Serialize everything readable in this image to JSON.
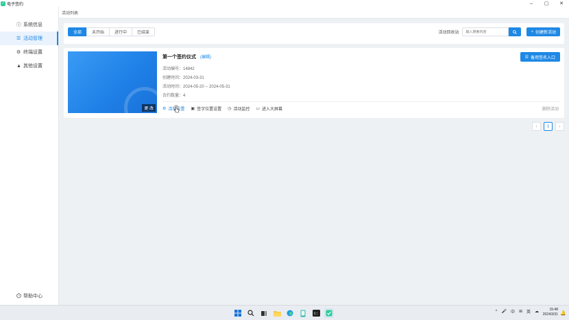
{
  "app": {
    "title": "电子签约"
  },
  "sidebar": {
    "items": [
      {
        "icon": "info-circle-icon",
        "glyph": "ⓘ",
        "label": "系统信息",
        "active": false
      },
      {
        "icon": "list-icon",
        "glyph": "☰",
        "label": "活动管理",
        "active": true
      },
      {
        "icon": "gear-icon",
        "glyph": "⚙",
        "label": "终端设置",
        "active": false
      },
      {
        "icon": "warning-icon",
        "glyph": "▲",
        "label": "其他设置",
        "active": false
      }
    ],
    "help": {
      "icon": "question-circle-icon",
      "glyph": "?",
      "label": "帮助中心"
    }
  },
  "breadcrumb": {
    "label": "活动列表"
  },
  "toolbar": {
    "filters": [
      "全部",
      "未开始",
      "进行中",
      "已结束"
    ],
    "active_filter": "全部",
    "search_label": "活动回收站",
    "search_placeholder": "输入搜索内容",
    "create_label": "创建新活动"
  },
  "activity": {
    "title": "第一个签约仪式",
    "edit_label": "(编辑)",
    "change_label": "更 改",
    "spare_entry_label": "备用签名入口",
    "meta": [
      {
        "label": "活动编号：",
        "value": "14842"
      },
      {
        "label": "创建时间：",
        "value": "2024-03-31"
      },
      {
        "label": "活动时间：",
        "value": "2024-05-20 -- 2024-05-31"
      },
      {
        "label": "合约数量：",
        "value": "4"
      }
    ],
    "actions": [
      {
        "icon": "gear-icon",
        "glyph": "⚙",
        "label": "活动设置"
      },
      {
        "icon": "layout-icon",
        "glyph": "▣",
        "label": "签字位置设置"
      },
      {
        "icon": "clock-icon",
        "glyph": "◷",
        "label": "活动监控"
      },
      {
        "icon": "monitor-icon",
        "glyph": "▭",
        "label": "进入大屏幕"
      }
    ],
    "delete_label": "删除活动"
  },
  "pagination": {
    "current": "1",
    "prev": "‹",
    "next": "›"
  },
  "taskbar": {
    "tray": [
      "^",
      "🎤",
      "中",
      "⊞",
      "英",
      "☁"
    ],
    "time": "15:48",
    "date": "2024/3/31"
  },
  "colors": {
    "accent": "#1e88e5",
    "background": "#eef1f4"
  }
}
